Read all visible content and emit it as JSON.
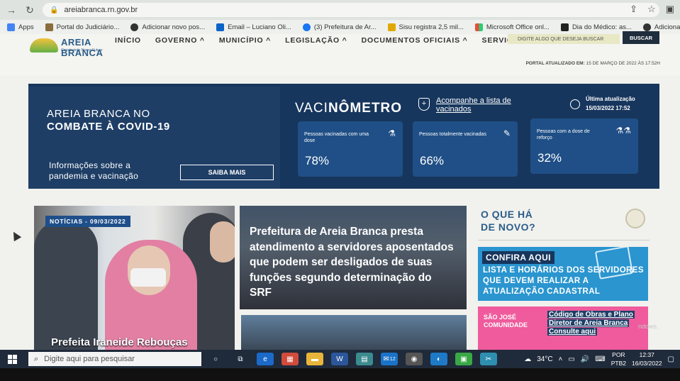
{
  "browser": {
    "url": "areiabranca.rn.gov.br",
    "bookmarks": [
      {
        "label": "Apps",
        "icon": "apps-grid-icon",
        "color": "#4285f4"
      },
      {
        "label": "Portal do Judiciário...",
        "icon": "judiciary-seal-icon",
        "color": "#8a6d3b"
      },
      {
        "label": "Adicionar novo pos...",
        "icon": "wordpress-icon",
        "color": "#333333"
      },
      {
        "label": "Email – Luciano Oli...",
        "icon": "outlook-icon",
        "color": "#0a64c8"
      },
      {
        "label": "(3) Prefeitura de Ar...",
        "icon": "facebook-icon",
        "color": "#1877f2"
      },
      {
        "label": "Sisu registra 2,5 mil...",
        "icon": "news-bolt-icon",
        "color": "#e0a800"
      },
      {
        "label": "Microsoft Office onl...",
        "icon": "microsoft-icon",
        "color": "#e74c3c"
      },
      {
        "label": "Dia do Médico: as...",
        "icon": "fm-icon",
        "color": "#222222"
      },
      {
        "label": "Adicionar novo pos...",
        "icon": "wordpress-icon",
        "color": "#333333"
      }
    ]
  },
  "site": {
    "logo_name": "AREIA BRANCA",
    "logo_tagline": "Construindo Nosso Futuro",
    "nav": [
      "INÍCIO",
      "GOVERNO",
      "MUNICÍPIO",
      "LEGISLAÇÃO",
      "DOCUMENTOS OFICIAIS",
      "SERVIÇOS"
    ],
    "search_placeholder": "DIGITE ALGO QUE DESEJA BUSCAR",
    "search_button": "BUSCAR",
    "updated_label": "PORTAL ATUALIZADO EM:",
    "updated_value": "15 DE MARÇO DE 2022 ÀS 17:52H"
  },
  "banner": {
    "title_line1": "AREIA BRANCA NO",
    "title_line2": "COMBATE À COVID-19",
    "info_line1": "Informações sobre a",
    "info_line2": "pandemia e vacinação",
    "cta": "SAIBA MAIS",
    "vac_prefix": "VACI",
    "vac_bold": "NÔMETRO",
    "follow_link": "Acompanhe a lista de vacinados",
    "last_update_label": "Última atualização",
    "last_update_value": "15/03/2022 17:52",
    "cards": [
      {
        "label": "Pessoas vacinadas com uma dose",
        "value": "78%",
        "icon": "vaccine-vial-icon"
      },
      {
        "label": "Pessoas totalmente vacinadas",
        "value": "66%",
        "icon": "syringe-icon"
      },
      {
        "label": "Pessoas com a dose de reforço",
        "value": "32%",
        "icon": "booster-vials-icon"
      }
    ]
  },
  "news": {
    "main_tag": "NOTÍCIAS - 09/03/2022",
    "main_caption": "Prefeita Iraneide Rebouças",
    "feature_headline": "Prefeitura de Areia Branca presta atendimento a servidores aposentados que podem ser desligados de suas funções segundo determinação do SRF"
  },
  "sidebar": {
    "heading_line1": "O QUE HÁ",
    "heading_line2": "DE NOVO?",
    "promo1_badge": "CONFIRA AQUI",
    "promo1_text": "LISTA E HORÁRIOS DOS SERVIDORES QUE DEVEM REALIZAR A ATUALIZAÇÃO CADASTRAL",
    "promo2_brand": "SÃO JOSÉ COMUNIDADE",
    "promo2_line1": "Código de Obras e Plano",
    "promo2_line2": "Diretor de Areia Branca",
    "promo2_line3": "Consulte aqui",
    "watermark": "ndows."
  },
  "taskbar": {
    "search_placeholder": "Digite aqui para pesquisar",
    "weather": "34°C",
    "language_line1": "POR",
    "language_line2": "PTB2",
    "time": "12:37",
    "date": "16/03/2022",
    "mail_badge": "12"
  }
}
